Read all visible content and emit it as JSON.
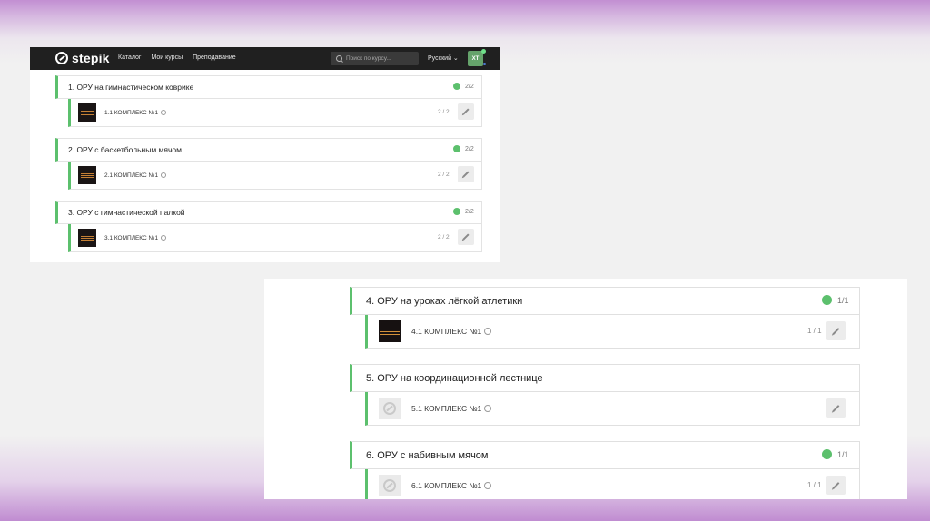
{
  "topbar": {
    "brand": "stepik",
    "nav": [
      "Каталог",
      "Мои курсы",
      "Преподавание"
    ],
    "search_placeholder": "Поиск по курсу...",
    "language": "Русский ⌄",
    "avatar_initials": "ХТ"
  },
  "colors": {
    "accent": "#5cc06d",
    "topbar": "#202020"
  },
  "modules_top": [
    {
      "title": "1. ОРУ на гимнастическом коврике",
      "progress": "2/2",
      "lesson": {
        "label": "1.1 КОМПЛЕКС №1",
        "progress": "2 / 2",
        "thumb": "dark-video-thumbnail"
      }
    },
    {
      "title": "2. ОРУ с баскетбольным мячом",
      "progress": "2/2",
      "lesson": {
        "label": "2.1 КОМПЛЕКС №1",
        "progress": "2 / 2",
        "thumb": "dark-video-thumbnail"
      }
    },
    {
      "title": "3. ОРУ с гимнастической палкой",
      "progress": "2/2",
      "lesson": {
        "label": "3.1 КОМПЛЕКС №1",
        "progress": "2 / 2",
        "thumb": "dark-video-thumbnail"
      }
    }
  ],
  "modules_bottom": [
    {
      "title": "4. ОРУ на уроках лёгкой атлетики",
      "progress": "1/1",
      "lesson": {
        "label": "4.1 КОМПЛЕКС №1",
        "progress": "1 / 1",
        "thumb": "dark-video-thumbnail"
      }
    },
    {
      "title": "5. ОРУ на координационной лестнице",
      "progress": "",
      "lesson": {
        "label": "5.1 КОМПЛЕКС №1",
        "progress": "",
        "thumb": "stepik-placeholder-icon"
      }
    },
    {
      "title": "6. ОРУ с набивным мячом",
      "progress": "1/1",
      "lesson": {
        "label": "6.1 КОМПЛЕКС №1",
        "progress": "1 / 1",
        "thumb": "stepik-placeholder-icon"
      }
    }
  ]
}
